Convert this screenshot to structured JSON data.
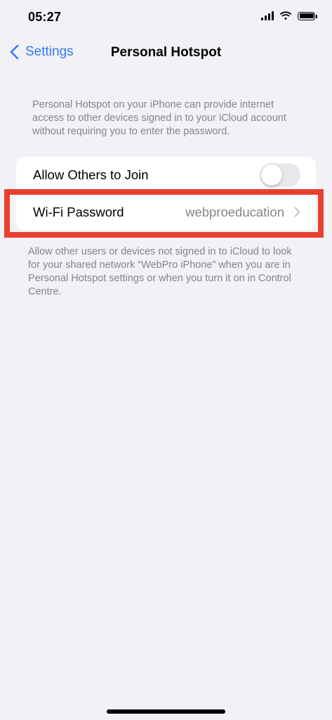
{
  "status_bar": {
    "time": "05:27",
    "icons": [
      "signal-icon",
      "wifi-icon",
      "battery-icon"
    ]
  },
  "nav": {
    "back_label": "Settings",
    "title": "Personal Hotspot",
    "accent_color": "#2f7cf6"
  },
  "header_text": "Personal Hotspot on your iPhone can provide internet access to other devices signed in to your iCloud account without requiring you to enter the password.",
  "rows": [
    {
      "label": "Allow Others to Join",
      "control": "toggle",
      "toggle_on": false
    },
    {
      "label": "Wi-Fi Password",
      "value": "webproeducation",
      "control": "chevron-right-icon"
    }
  ],
  "footer_text": "Allow other users or devices not signed in to iCloud to look for your shared network “WebPro iPhone” when you are in Personal Hotspot settings or when you turn it on in Control Centre.",
  "annotation": {
    "highlight_color": "#e8402e"
  }
}
